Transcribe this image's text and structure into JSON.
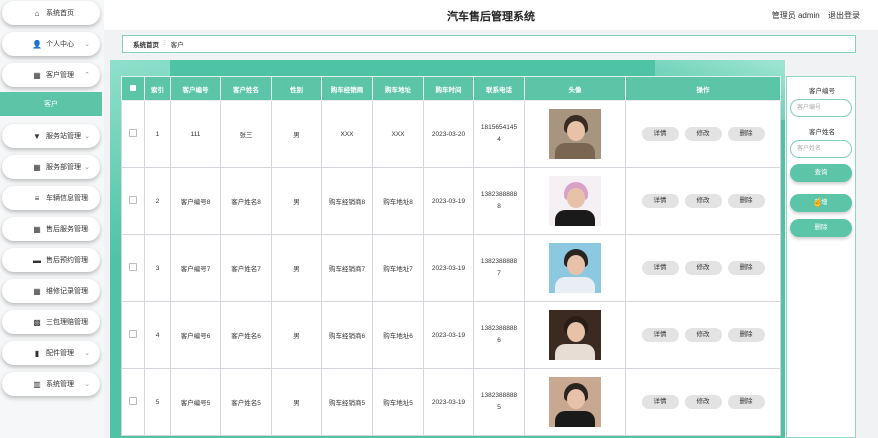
{
  "header": {
    "title": "汽车售后管理系统",
    "user": "管理员 admin",
    "logout": "退出登录"
  },
  "sidebar": {
    "items": [
      {
        "label": "系统首页",
        "icon": "home-icon",
        "glyph": "⌂",
        "chev": ""
      },
      {
        "label": "个人中心",
        "icon": "user-icon",
        "glyph": "👤",
        "chev": "⌄"
      },
      {
        "label": "客户管理",
        "icon": "grid-icon",
        "glyph": "▦",
        "chev": "⌃"
      },
      {
        "label": "服务站管理",
        "icon": "station-icon",
        "glyph": "▼",
        "chev": "⌄"
      },
      {
        "label": "服务部管理",
        "icon": "grid-icon",
        "glyph": "▦",
        "chev": "⌄"
      },
      {
        "label": "车辆信息管理",
        "icon": "list-icon",
        "glyph": "≡",
        "chev": "⌄"
      },
      {
        "label": "售后服务管理",
        "icon": "grid-icon",
        "glyph": "▦",
        "chev": "⌄"
      },
      {
        "label": "售后预约管理",
        "icon": "monitor-icon",
        "glyph": "▬",
        "chev": "⌄"
      },
      {
        "label": "维修记录管理",
        "icon": "grid-icon",
        "glyph": "▦",
        "chev": "⌄"
      },
      {
        "label": "三包理赔管理",
        "icon": "ticket-icon",
        "glyph": "▩",
        "chev": "⌄"
      },
      {
        "label": "配件管理",
        "icon": "bar-chart-icon",
        "glyph": "▮",
        "chev": "⌄"
      },
      {
        "label": "系统管理",
        "icon": "building-icon",
        "glyph": "▥",
        "chev": "⌄"
      }
    ],
    "active_sub": "客户"
  },
  "breadcrumb": {
    "home": "系统首页",
    "sep": "⫶",
    "current": "客户"
  },
  "table": {
    "headers": [
      "索引",
      "客户编号",
      "客户姓名",
      "性别",
      "购车经销商",
      "购车地址",
      "购车时间",
      "联系电话",
      "头像",
      "操作"
    ],
    "ops": {
      "detail": "详情",
      "edit": "修改",
      "delete": "删除"
    },
    "rows": [
      {
        "index": "1",
        "code": "111",
        "name": "张三",
        "gender": "男",
        "dealer": "XXX",
        "address": "XXX",
        "date": "2023-03-20",
        "phone": "18156541454",
        "avatar": "#a89580",
        "hair": "#3a2b22",
        "body": "#7a6650"
      },
      {
        "index": "2",
        "code": "客户编号8",
        "name": "客户姓名8",
        "gender": "男",
        "dealer": "购车经销商8",
        "address": "购车地址8",
        "date": "2023-03-19",
        "phone": "13823888888",
        "avatar": "#f4f0f4",
        "hair": "#d9a0c8",
        "body": "#1a1a1a"
      },
      {
        "index": "3",
        "code": "客户编号7",
        "name": "客户姓名7",
        "gender": "男",
        "dealer": "购车经销商7",
        "address": "购车地址7",
        "date": "2023-03-19",
        "phone": "13823888887",
        "avatar": "#8cc8e0",
        "hair": "#2a2420",
        "body": "#e8eef4"
      },
      {
        "index": "4",
        "code": "客户编号6",
        "name": "客户姓名6",
        "gender": "男",
        "dealer": "购车经销商6",
        "address": "购车地址6",
        "date": "2023-03-19",
        "phone": "13823888886",
        "avatar": "#3a2a22",
        "hair": "#2a1c16",
        "body": "#e8ddd4"
      },
      {
        "index": "5",
        "code": "客户编号5",
        "name": "客户姓名5",
        "gender": "男",
        "dealer": "购车经销商5",
        "address": "购车地址5",
        "date": "2023-03-19",
        "phone": "13823888885",
        "avatar": "#c8a890",
        "hair": "#2a2420",
        "body": "#1a1a1a"
      }
    ]
  },
  "search": {
    "code_label": "客户编号",
    "code_placeholder": "客户编号",
    "name_label": "客户姓名",
    "name_placeholder": "客户姓名",
    "query": "查询",
    "add": "新增",
    "delete": "删除"
  }
}
